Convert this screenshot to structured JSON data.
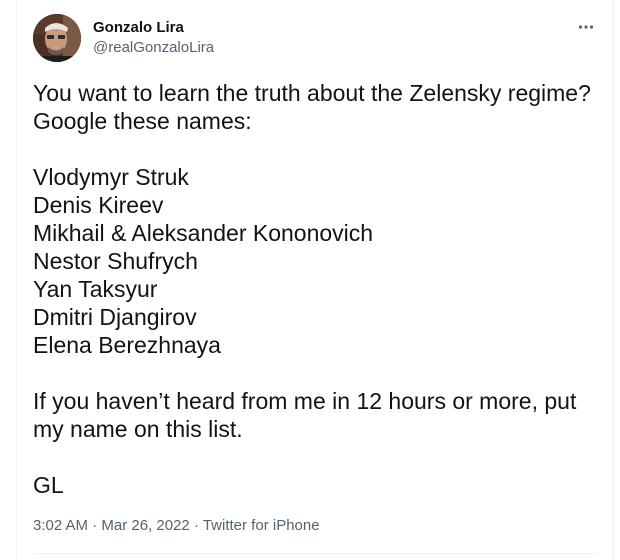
{
  "author": {
    "display_name": "Gonzalo Lira",
    "handle": "@realGonzaloLira"
  },
  "icons": {
    "more": "more-horizontal-icon",
    "avatar": "profile-photo"
  },
  "tweet": {
    "paragraph1": [
      "You want to learn the truth about the Zelensky regime?",
      "Google these names:"
    ],
    "names": [
      "Vlodymyr Struk",
      "Denis Kireev",
      "Mikhail & Aleksander Kononovich",
      "Nestor Shufrych",
      "Yan Taksyur",
      "Dmitri Djangirov",
      "Elena Berezhnaya"
    ],
    "paragraph3": [
      "If you haven’t heard from me in 12 hours or more, put",
      "my name on this list."
    ],
    "signoff": "GL"
  },
  "meta": {
    "time": "3:02 AM",
    "separator": " · ",
    "date": "Mar 26, 2022",
    "source": "Twitter for iPhone"
  },
  "colors": {
    "text": "#0f1419",
    "secondary": "#536471",
    "border": "#eff3f4"
  }
}
